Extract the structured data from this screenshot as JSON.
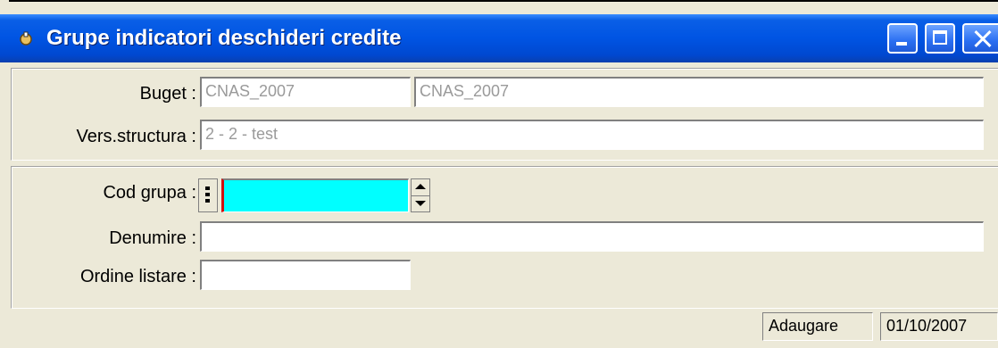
{
  "window": {
    "title": "Grupe indicatori deschideri credite"
  },
  "header": {
    "buget": {
      "label": "Buget :",
      "code": "CNAS_2007",
      "name": "CNAS_2007"
    },
    "versiune": {
      "label": "Vers.structura :",
      "value": "2 - 2 - test"
    }
  },
  "form": {
    "cod_grupa": {
      "label": "Cod grupa :",
      "value": ""
    },
    "denumire": {
      "label": "Denumire :",
      "value": ""
    },
    "ordine_listare": {
      "label": "Ordine listare :",
      "value": ""
    }
  },
  "statusbar": {
    "mode": "Adaugare",
    "date": "01/10/2007"
  },
  "colors": {
    "titlebar": "#0054e3",
    "active_field": "#00ffff",
    "window_bg": "#ece9d8"
  }
}
